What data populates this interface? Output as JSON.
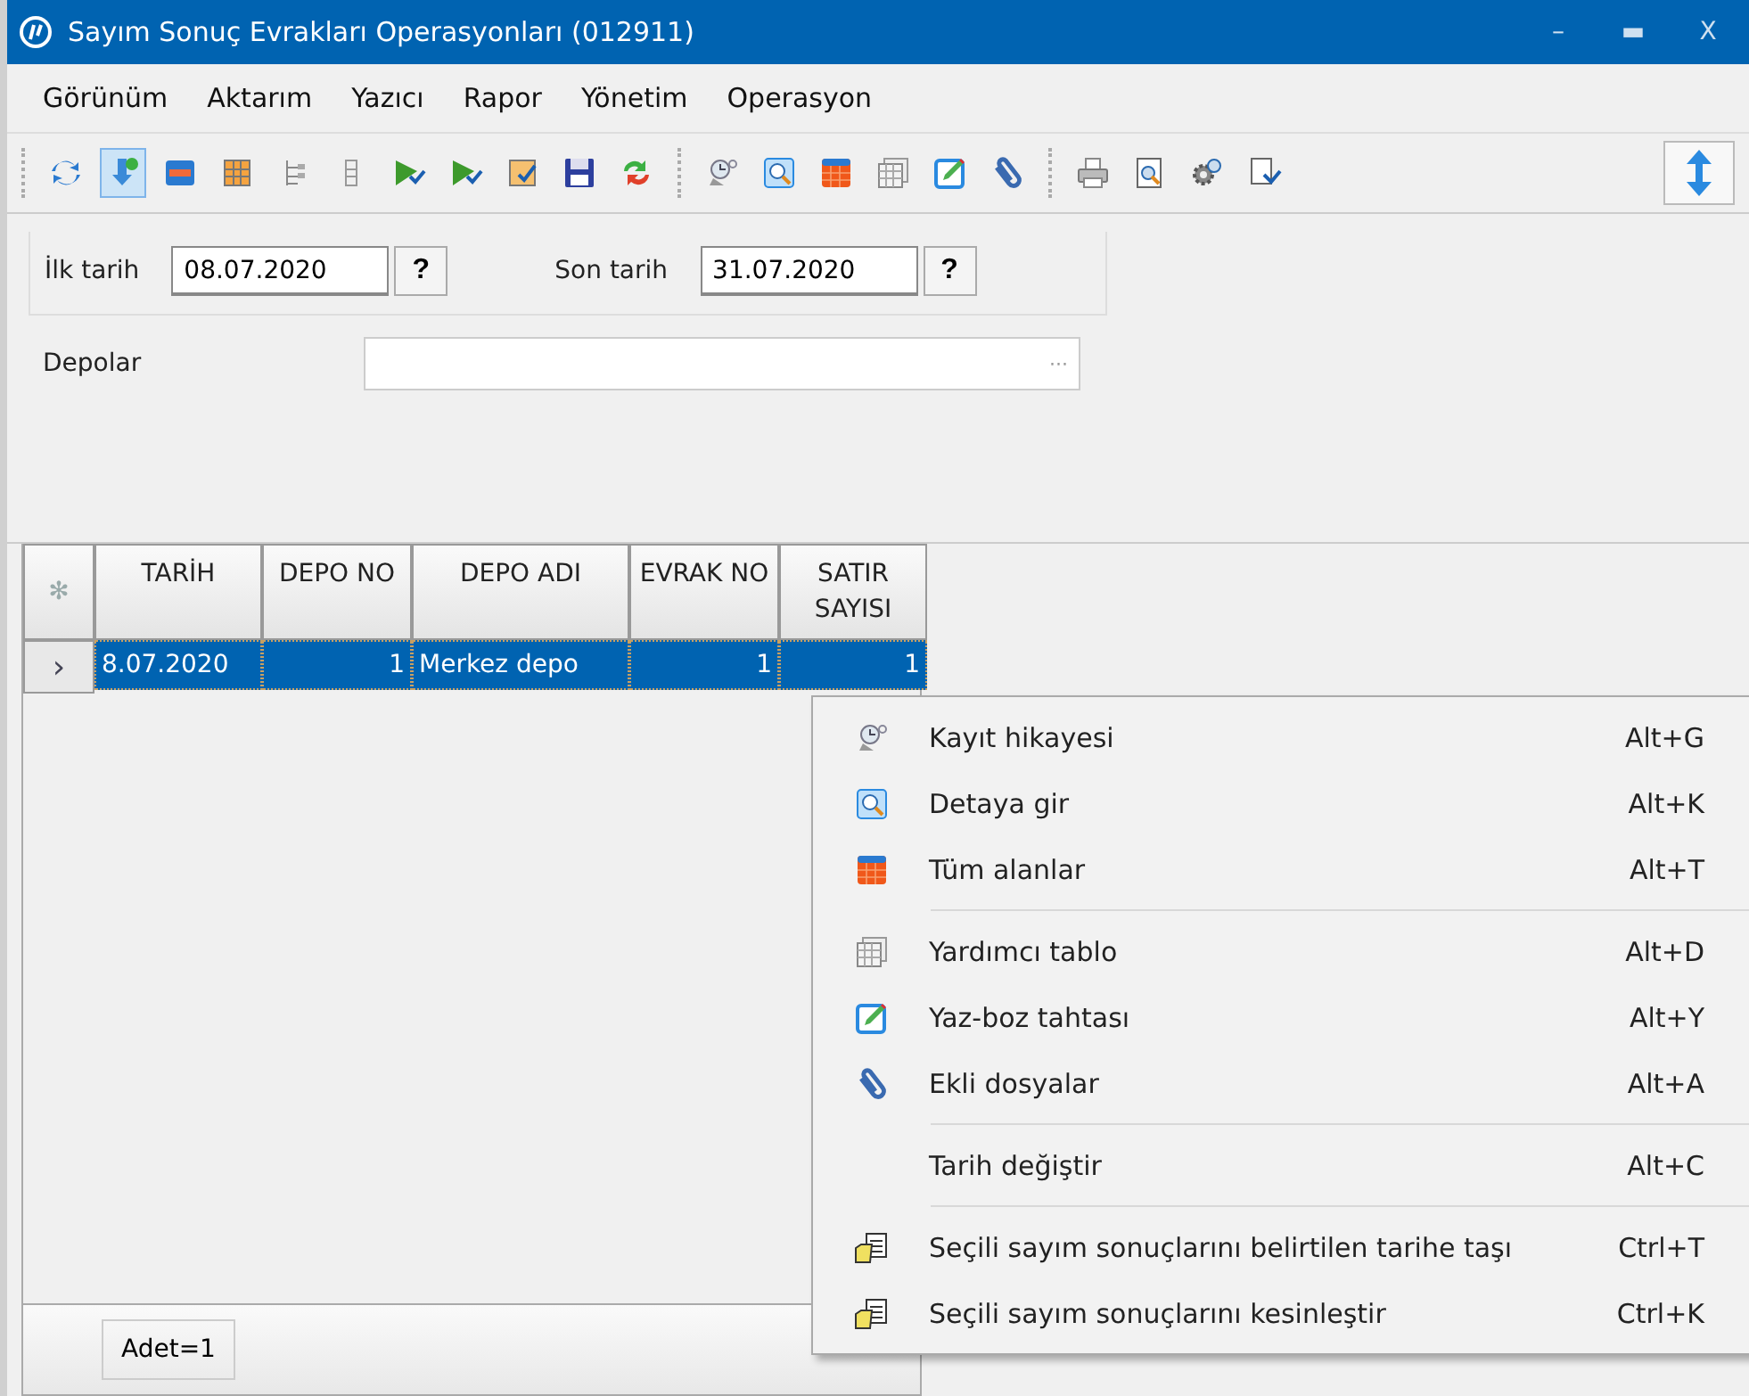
{
  "window": {
    "title": "Sayım Sonuç Evrakları Operasyonları (012911)",
    "controls": [
      "–",
      "▬",
      "X"
    ]
  },
  "menu": [
    "Görünüm",
    "Aktarım",
    "Yazıcı",
    "Rapor",
    "Yönetim",
    "Operasyon"
  ],
  "toolbar": [
    [
      {
        "kind": "refresh",
        "selected": false
      },
      {
        "kind": "import",
        "selected": true
      },
      {
        "kind": "form",
        "selected": false
      },
      {
        "kind": "grid",
        "selected": false
      },
      {
        "kind": "tree",
        "selected": false
      },
      {
        "kind": "list",
        "selected": false
      },
      {
        "kind": "flag",
        "selected": false
      },
      {
        "kind": "flag",
        "selected": false
      },
      {
        "kind": "checklist",
        "selected": false
      },
      {
        "kind": "save",
        "selected": false
      },
      {
        "kind": "swap",
        "selected": false
      }
    ],
    [
      {
        "kind": "history",
        "selected": false
      },
      {
        "kind": "zoom",
        "selected": false
      },
      {
        "kind": "table",
        "selected": false
      },
      {
        "kind": "table2",
        "selected": false
      },
      {
        "kind": "edit",
        "selected": false
      },
      {
        "kind": "clip",
        "selected": false
      }
    ],
    [
      {
        "kind": "print",
        "selected": false
      },
      {
        "kind": "preview",
        "selected": false
      },
      {
        "kind": "settings",
        "selected": false
      },
      {
        "kind": "export",
        "selected": false
      }
    ]
  ],
  "filters": {
    "first_date": {
      "label": "İlk tarih",
      "value": "08.07.2020",
      "help": "?"
    },
    "last_date": {
      "label": "Son tarih",
      "value": "31.07.2020",
      "help": "?"
    },
    "depots": {
      "label": "Depolar",
      "button": "···"
    }
  },
  "table": {
    "corner": "✻",
    "columns": [
      "TARİH",
      "DEPO NO",
      "DEPO ADI",
      "EVRAK NO",
      "SATIR SAYISI"
    ],
    "rows": [
      {
        "indicator": "›",
        "selected": true,
        "cells": [
          "8.07.2020",
          "1",
          "Merkez depo",
          "1",
          "1"
        ]
      }
    ]
  },
  "status_bar": {
    "count": "Adet=1"
  },
  "context_menu": [
    [
      {
        "kind": "history",
        "label": "Kayıt hikayesi",
        "shortcut": "Alt+G"
      },
      {
        "kind": "zoom",
        "label": "Detaya gir",
        "shortcut": "Alt+K"
      },
      {
        "kind": "table",
        "label": "Tüm alanlar",
        "shortcut": "Alt+T"
      }
    ],
    [
      {
        "kind": "table2",
        "label": "Yardımcı tablo",
        "shortcut": "Alt+D"
      },
      {
        "kind": "edit",
        "label": "Yaz-boz tahtası",
        "shortcut": "Alt+Y"
      },
      {
        "kind": "clip",
        "label": "Ekli dosyalar",
        "shortcut": "Alt+A"
      }
    ],
    [
      {
        "kind": "none",
        "label": "Tarih değiştir",
        "shortcut": "Alt+C"
      }
    ],
    [
      {
        "kind": "folder",
        "label": "Seçili sayım sonuçlarını belirtilen tarihe taşı",
        "shortcut": "Ctrl+T"
      },
      {
        "kind": "folder",
        "label": "Seçili sayım sonuçlarını kesinleştir",
        "shortcut": "Ctrl+K"
      }
    ]
  ]
}
